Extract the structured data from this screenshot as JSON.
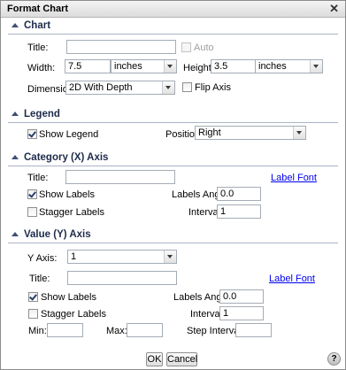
{
  "window": {
    "title": "Format Chart",
    "close_glyph": "✕"
  },
  "chart": {
    "heading": "Chart",
    "title_label": "Title:",
    "title_value": "",
    "auto_label": "Auto",
    "auto_checked": false,
    "width_label": "Width:",
    "width_value": "7.5",
    "width_unit": "inches",
    "height_label": "Height:",
    "height_value": "3.5",
    "height_unit": "inches",
    "dimension_label": "Dimension:",
    "dimension_value": "2D With Depth",
    "flip_axis_label": "Flip Axis",
    "flip_axis_checked": false
  },
  "legend": {
    "heading": "Legend",
    "show_legend_label": "Show Legend",
    "show_legend_checked": true,
    "position_label": "Position:",
    "position_value": "Right"
  },
  "category_axis": {
    "heading": "Category (X) Axis",
    "title_label": "Title:",
    "title_value": "",
    "label_font_link": "Label Font",
    "show_labels_label": "Show Labels",
    "show_labels_checked": true,
    "labels_angle_label": "Labels Angle:",
    "labels_angle_value": "0.0",
    "stagger_labels_label": "Stagger Labels",
    "stagger_labels_checked": false,
    "interval_label": "Interval:",
    "interval_value": "1"
  },
  "value_axis": {
    "heading": "Value (Y) Axis",
    "y_axis_label": "Y Axis:",
    "y_axis_value": "1",
    "title_label": "Title:",
    "title_value": "",
    "label_font_link": "Label Font",
    "show_labels_label": "Show Labels",
    "show_labels_checked": true,
    "labels_angle_label": "Labels Angle:",
    "labels_angle_value": "0.0",
    "stagger_labels_label": "Stagger Labels",
    "stagger_labels_checked": false,
    "interval_label": "Interval:",
    "interval_value": "1",
    "min_label": "Min:",
    "min_value": "",
    "max_label": "Max:",
    "max_value": "",
    "step_interval_label": "Step Interval:",
    "step_interval_value": ""
  },
  "footer": {
    "ok_label": "OK",
    "cancel_label": "Cancel",
    "help_glyph": "?"
  },
  "colors": {
    "section_heading": "#1e2b4a",
    "link": "#0000ee",
    "titlebar": "#dcdcdc"
  }
}
